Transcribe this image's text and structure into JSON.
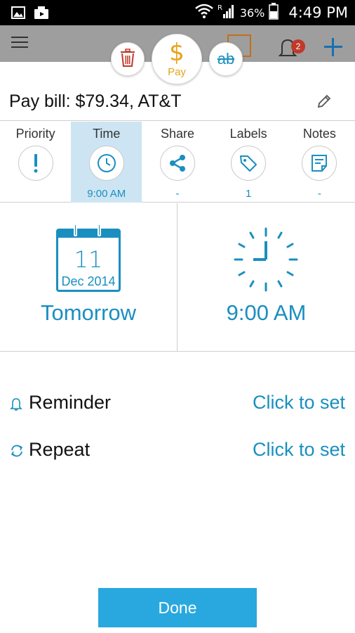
{
  "status_bar": {
    "battery_percent": "36%",
    "time": "4:49 PM"
  },
  "app_bar": {
    "notification_count": "2"
  },
  "actions": {
    "pay_label": "Pay",
    "pay_symbol": "$",
    "strike_text": "ab"
  },
  "task": {
    "title": "Pay bill: $79.34, AT&T"
  },
  "tabs": [
    {
      "label": "Priority",
      "value": ""
    },
    {
      "label": "Time",
      "value": "9:00 AM"
    },
    {
      "label": "Share",
      "value": "-"
    },
    {
      "label": "Labels",
      "value": "1"
    },
    {
      "label": "Notes",
      "value": "-"
    }
  ],
  "date": {
    "day": "11",
    "month_year": "Dec 2014",
    "label": "Tomorrow"
  },
  "time": {
    "label": "9:00 AM"
  },
  "settings": {
    "reminder_label": "Reminder",
    "reminder_value": "Click to set",
    "repeat_label": "Repeat",
    "repeat_value": "Click to set"
  },
  "footer": {
    "done_label": "Done"
  },
  "colors": {
    "accent": "#1a8fbf",
    "done_button": "#29a8df",
    "pay": "#e8a317",
    "delete": "#c0392b",
    "active_tab": "#cde5f3"
  }
}
